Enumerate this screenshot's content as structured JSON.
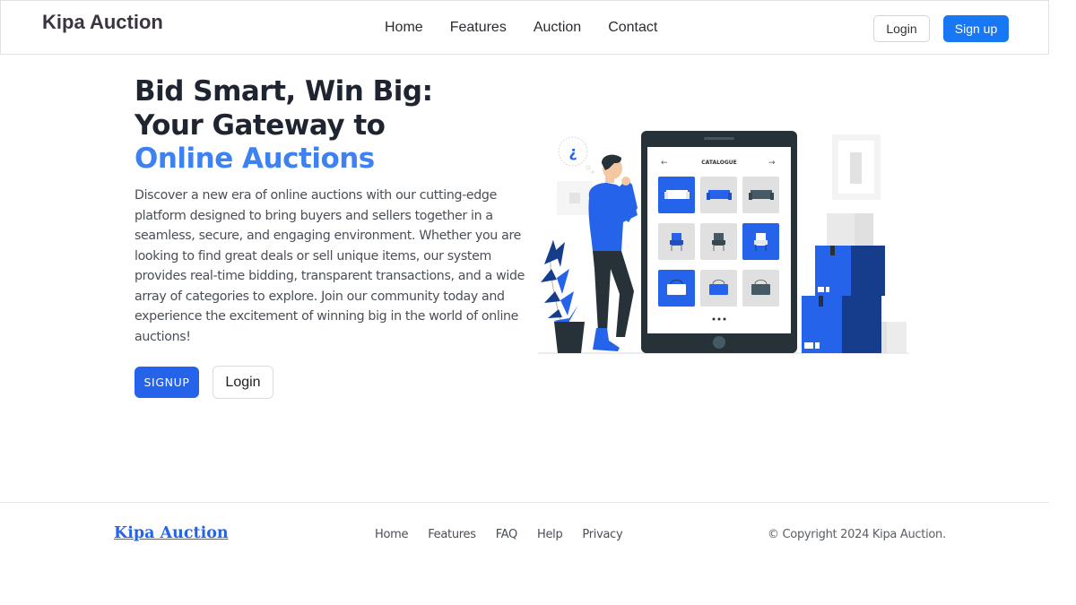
{
  "header": {
    "brand": "Kipa Auction",
    "nav": [
      {
        "label": "Home"
      },
      {
        "label": "Features"
      },
      {
        "label": "Auction"
      },
      {
        "label": "Contact"
      }
    ],
    "login_label": "Login",
    "signup_label": "Sign up"
  },
  "hero": {
    "title_line1": "Bid Smart, Win Big:",
    "title_line2": "Your Gateway to",
    "title_accent": "Online Auctions",
    "description": "Discover a new era of online auctions with our cutting-edge platform designed to bring buyers and sellers together in a seamless, secure, and engaging environment. Whether you are looking to find great deals or sell unique items, our system provides real-time bidding, transparent transactions, and a wide array of categories to explore. Join our community today and experience the excitement of winning big in the world of online auctions!",
    "signup_label": "SIGNUP",
    "login_label": "Login",
    "illustration": {
      "catalogue_label": "CATALOGUE",
      "thought_glyph": "¿",
      "grid_items": [
        "sofa",
        "sofa",
        "sofa",
        "armchair",
        "armchair",
        "armchair",
        "bag",
        "bag",
        "bag"
      ]
    }
  },
  "footer": {
    "brand": "Kipa Auction",
    "links": [
      {
        "label": "Home"
      },
      {
        "label": "Features"
      },
      {
        "label": "FAQ"
      },
      {
        "label": "Help"
      },
      {
        "label": "Privacy"
      }
    ],
    "copyright": "© Copyright 2024 Kipa Auction."
  },
  "colors": {
    "primary": "#1877f2",
    "hero_button": "#2563eb",
    "accent_text": "#3d82f0",
    "dark_text": "#1e2430",
    "illustration_blue": "#2563eb",
    "illustration_navy": "#163d8c",
    "illustration_dark": "#263238"
  }
}
